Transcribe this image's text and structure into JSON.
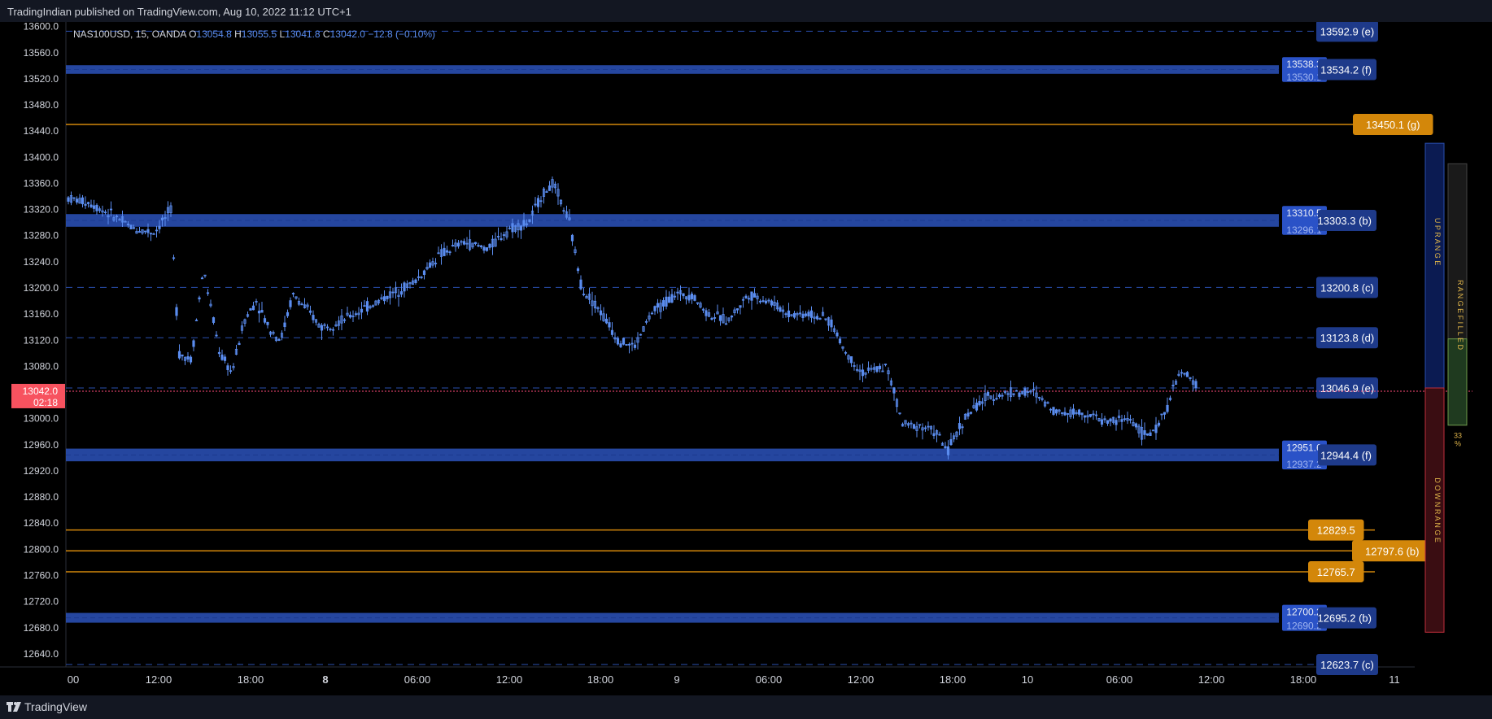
{
  "header": {
    "published": "TradingIndian published on TradingView.com, Aug 10, 2022 11:12 UTC+1"
  },
  "footer": {
    "brand": "TradingView"
  },
  "chart_data": {
    "type": "candlestick",
    "symbol": "NAS100USD, 15, OANDA",
    "ohlc": {
      "o_label": "O",
      "o": "13054.8",
      "h_label": "H",
      "h": "13055.5",
      "l_label": "L",
      "l": "13041.8",
      "c_label": "C",
      "c": "13042.0",
      "change": "−12.8 (−0.10%)"
    },
    "y_ticks": [
      "13600.0",
      "13560.0",
      "13520.0",
      "13480.0",
      "13440.0",
      "13400.0",
      "13360.0",
      "13320.0",
      "13280.0",
      "13240.0",
      "13200.0",
      "13160.0",
      "13120.0",
      "13080.0",
      "13040.0",
      "13000.0",
      "12960.0",
      "12920.0",
      "12880.0",
      "12840.0",
      "12800.0",
      "12760.0",
      "12720.0",
      "12680.0",
      "12640.0"
    ],
    "x_ticks": [
      {
        "label": "00",
        "bold": false
      },
      {
        "label": "12:00",
        "bold": false
      },
      {
        "label": "18:00",
        "bold": false
      },
      {
        "label": "8",
        "bold": true
      },
      {
        "label": "06:00",
        "bold": false
      },
      {
        "label": "12:00",
        "bold": false
      },
      {
        "label": "18:00",
        "bold": false
      },
      {
        "label": "9",
        "bold": false
      },
      {
        "label": "06:00",
        "bold": false
      },
      {
        "label": "12:00",
        "bold": false
      },
      {
        "label": "18:00",
        "bold": false
      },
      {
        "label": "10",
        "bold": false
      },
      {
        "label": "06:00",
        "bold": false
      },
      {
        "label": "12:00",
        "bold": false
      },
      {
        "label": "18:00",
        "bold": false
      },
      {
        "label": "11",
        "bold": false
      }
    ],
    "price_range": [
      12620,
      13607
    ],
    "last_price": {
      "price": 13042.0,
      "label": "13042.0",
      "countdown": "02:18",
      "color": "#f7525f"
    },
    "levels": [
      {
        "price": 13592.9,
        "label": "13592.9 (e)",
        "kind": "dash"
      },
      {
        "price": 13534.2,
        "label": "13534.2 (f)",
        "kind": "band",
        "band_lo": 13530.1,
        "band_hi": 13538.3,
        "band_labels": [
          "13538.3",
          "13530.1"
        ]
      },
      {
        "price": 13450.1,
        "label": "13450.1 (g)",
        "kind": "orange"
      },
      {
        "price": 13303.3,
        "label": "13303.3 (b)",
        "kind": "band",
        "band_lo": 13296.1,
        "band_hi": 13310.5,
        "band_labels": [
          "13310.5",
          "13296.1"
        ]
      },
      {
        "price": 13200.8,
        "label": "13200.8 (c)",
        "kind": "dash"
      },
      {
        "price": 13123.8,
        "label": "13123.8 (d)",
        "kind": "dash"
      },
      {
        "price": 13046.9,
        "label": "13046.9 (e)",
        "kind": "dash"
      },
      {
        "price": 12944.4,
        "label": "12944.4 (f)",
        "kind": "band",
        "band_lo": 12937.2,
        "band_hi": 12951.6,
        "band_labels": [
          "12951.6",
          "12937.2"
        ]
      },
      {
        "price": 12829.5,
        "label": "12829.5",
        "kind": "orange"
      },
      {
        "price": 12797.6,
        "label": "12797.6 (b)",
        "kind": "orange"
      },
      {
        "price": 12765.7,
        "label": "12765.7",
        "kind": "orange"
      },
      {
        "price": 12695.2,
        "label": "12695.2 (b)",
        "kind": "band",
        "band_lo": 12690.2,
        "band_hi": 12700.2,
        "band_labels": [
          "12700.2",
          "12690.2"
        ]
      },
      {
        "price": 12623.7,
        "label": "12623.7 (c)",
        "kind": "dash"
      }
    ],
    "range_panel": {
      "up_label": "U P   R A N G E",
      "down_label": "D O W N   R A N G E",
      "filled_label": "R A N G E   F I L L E D",
      "pct_value": "33",
      "pct_unit": "%",
      "filled_fraction": 0.33
    },
    "colors": {
      "candle": "#5b8def",
      "dash": "#2a4fb0",
      "band": "#2e57c7",
      "orange": "#d3870a",
      "axis_text": "#d1d4dc",
      "bg": "#000000",
      "panel": "#131722"
    }
  }
}
